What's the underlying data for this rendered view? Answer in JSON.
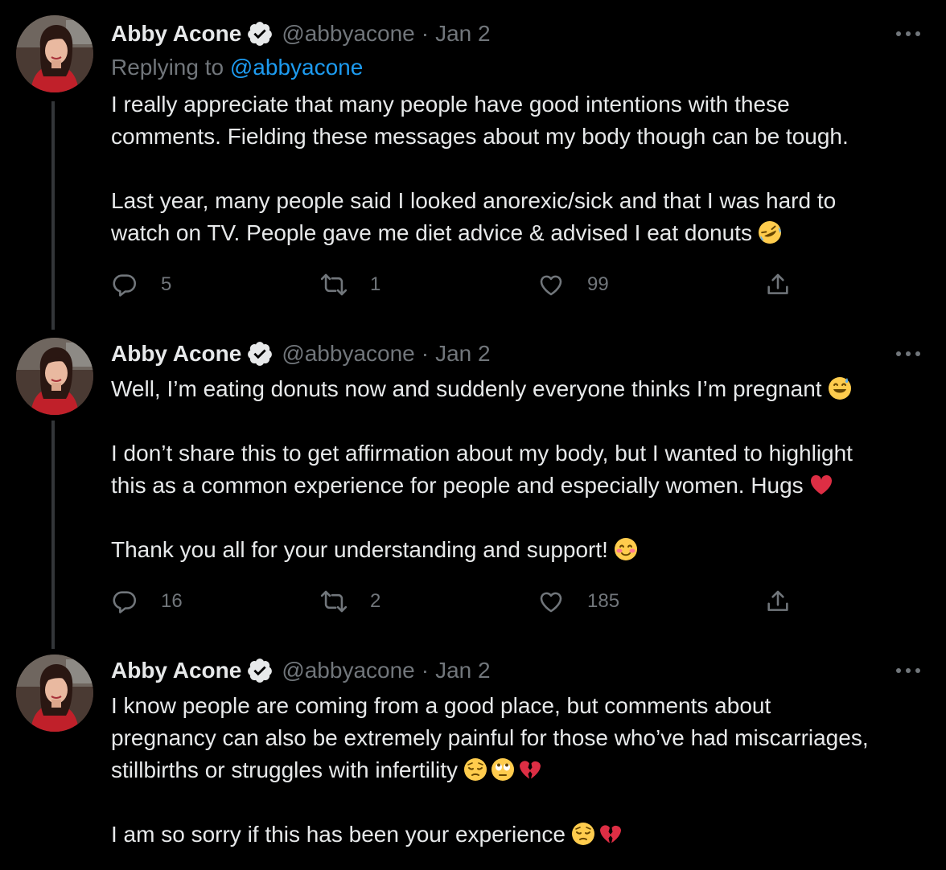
{
  "author": {
    "name": "Abby Acone",
    "handle": "@abbyacone"
  },
  "colors": {
    "background": "#000000",
    "text": "#e7e9ea",
    "muted": "#71767b",
    "link": "#1d9bf0",
    "thread_line": "#333639"
  },
  "tweets": [
    {
      "date": "Jan 2",
      "reply_to_prefix": "Replying to",
      "reply_to_handle": "@abbyacone",
      "paragraphs": [
        [
          "I really appreciate that many people have good intentions with these",
          "comments. Fielding these messages about my body though can be tough."
        ],
        [
          "Last year, many people said I looked anorexic/sick and that I was hard to",
          "watch on TV. People gave me diet advice & advised I eat donuts"
        ]
      ],
      "emojis": [
        "rofl"
      ],
      "replies": "5",
      "retweets": "1",
      "likes": "99"
    },
    {
      "date": "Jan 2",
      "paragraphs": [
        [
          "Well, I’m eating donuts now and suddenly everyone thinks I’m pregnant"
        ],
        [
          "I don’t share this to get affirmation about my body, but I wanted to highlight",
          "this as a common experience for people and especially women. Hugs"
        ],
        [
          "Thank you all for your understanding and support!"
        ]
      ],
      "emojis": [
        "sweat-smile",
        "red-heart",
        "blush"
      ],
      "replies": "16",
      "retweets": "2",
      "likes": "185"
    },
    {
      "date": "Jan 2",
      "paragraphs": [
        [
          "I know people are coming from a good place, but comments about",
          "pregnancy can also be extremely painful for those who’ve had miscarriages,",
          "stillbirths or struggles with infertility"
        ],
        [
          "I am so sorry if this has been your experience"
        ]
      ],
      "emojis": [
        "pensive",
        "rolling-eyes",
        "broken-heart",
        "pensive",
        "broken-heart"
      ]
    }
  ]
}
